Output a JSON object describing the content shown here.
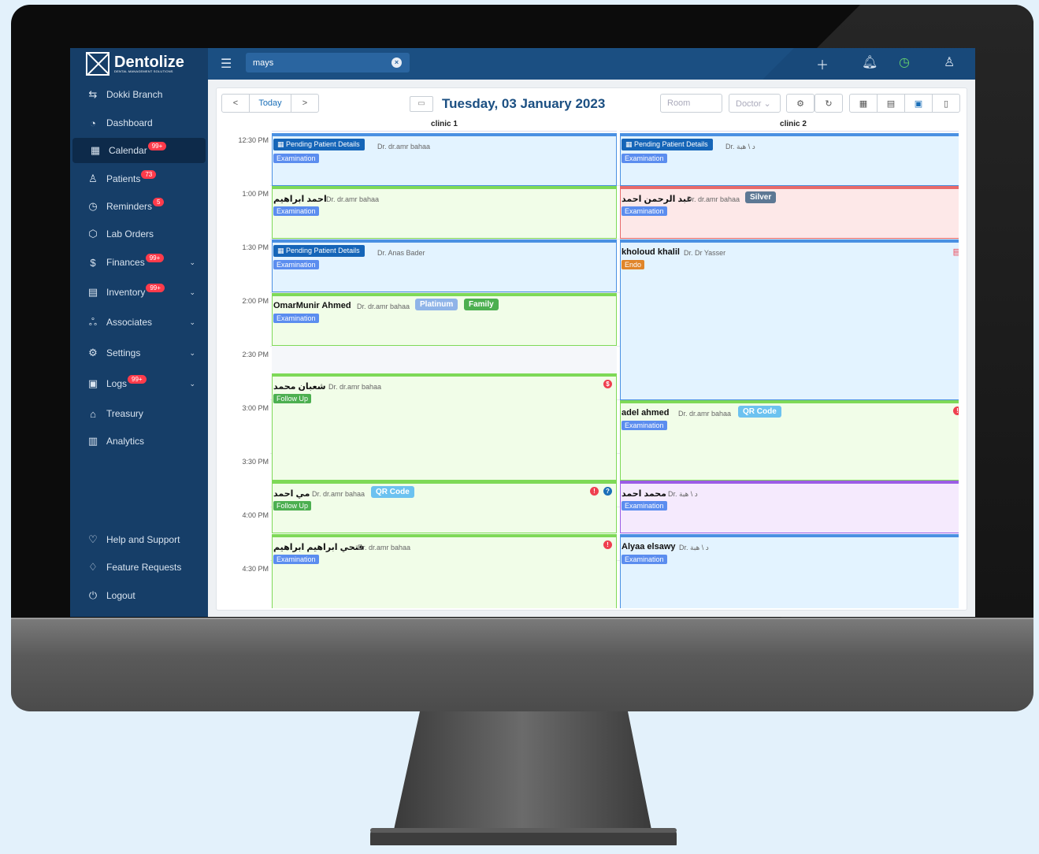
{
  "sidebar": {
    "brand": "Dentolize",
    "brand_sub": "DENTAL MANAGEMENT SOLUTIONS",
    "branch": "Dokki Branch",
    "items": [
      {
        "label": "Dashboard",
        "icon": "dashboard-icon"
      },
      {
        "label": "Calendar",
        "badge": "99+",
        "icon": "calendar-icon"
      },
      {
        "label": "Patients",
        "badge": "73",
        "icon": "patients-icon"
      },
      {
        "label": "Reminders",
        "badge": "5",
        "icon": "reminder-icon"
      },
      {
        "label": "Lab Orders",
        "icon": "lab-icon"
      },
      {
        "label": "Finances",
        "badge": "99+",
        "icon": "finance-icon"
      },
      {
        "label": "Inventory",
        "badge": "99+",
        "icon": "inventory-icon"
      },
      {
        "label": "Associates",
        "icon": "associates-icon"
      },
      {
        "label": "Settings",
        "icon": "settings-icon"
      },
      {
        "label": "Logs",
        "badge": "99+",
        "icon": "logs-icon"
      },
      {
        "label": "Treasury",
        "icon": "treasury-icon"
      },
      {
        "label": "Analytics",
        "icon": "analytics-icon"
      }
    ],
    "footer": [
      {
        "label": "Help and Support",
        "icon": "heart-icon"
      },
      {
        "label": "Feature Requests",
        "icon": "feature-icon"
      },
      {
        "label": "Logout",
        "icon": "power-icon"
      }
    ]
  },
  "topbar": {
    "search_value": "mays",
    "icons": [
      "plus-icon",
      "bell-icon",
      "clock-icon",
      "user-icon"
    ]
  },
  "toolbar": {
    "prev": "<",
    "today": "Today",
    "next": ">",
    "date_title": "Tuesday, 03 January 2023",
    "room_placeholder": "Room",
    "doctor_placeholder": "Doctor"
  },
  "calendar": {
    "columns": [
      "clinic 1",
      "clinic 2"
    ],
    "times": [
      "12:30 PM",
      "1:00 PM",
      "1:30 PM",
      "2:00 PM",
      "2:30 PM",
      "3:00 PM",
      "3:30 PM",
      "4:00 PM",
      "4:30 PM"
    ],
    "appointments": {
      "c1_1": {
        "pending": "Pending Patient Details",
        "doctor": "Dr. dr.amr bahaa",
        "tag": "Examination"
      },
      "c1_2": {
        "name": "احمد ابراهيم",
        "doctor": "Dr. dr.amr bahaa",
        "tag": "Examination"
      },
      "c1_3": {
        "pending": "Pending Patient Details",
        "doctor": "Dr. Anas Bader",
        "tag": "Examination"
      },
      "c1_4": {
        "name": "OmarMunir Ahmed",
        "doctor": "Dr. dr.amr bahaa",
        "badge1": "Platinum",
        "badge2": "Family",
        "tag": "Examination"
      },
      "c1_5": {
        "name": "شعبان محمد",
        "doctor": "Dr. dr.amr bahaa",
        "tag": "Follow Up",
        "dot": "$"
      },
      "c1_6": {
        "name": "مي احمد",
        "doctor": "Dr. dr.amr bahaa",
        "badge1": "QR Code",
        "tag": "Follow Up",
        "dot1": "!",
        "dot2": "?"
      },
      "c1_7": {
        "name": "فتحي ابراهيم ابراهيم",
        "doctor": "Dr. dr.amr bahaa",
        "tag": "Examination",
        "dot": "!"
      },
      "c2_1": {
        "pending": "Pending Patient Details",
        "doctor": "Dr. د \\ هبة",
        "tag": "Examination"
      },
      "c2_2": {
        "name": "عبد الرحمن احمد",
        "doctor": "Dr. dr.amr bahaa",
        "badge1": "Silver",
        "tag": "Examination"
      },
      "c2_3": {
        "name": "kholoud khalil",
        "doctor": "Dr. Dr Yasser",
        "tag": "Endo"
      },
      "c2_4": {
        "name": "adel ahmed",
        "doctor": "Dr. dr.amr bahaa",
        "badge1": "QR Code",
        "tag": "Examination",
        "dot": "!"
      },
      "c2_5": {
        "name": "محمد احمد",
        "doctor": "Dr. د \\ هبة",
        "tag": "Examination"
      },
      "c2_6": {
        "name": "Alyaa elsawy",
        "doctor": "Dr. د \\ هبة",
        "tag": "Examination"
      }
    }
  },
  "colors": {
    "sidebar": "#163e68",
    "topbar": "#1b4f82",
    "examination": "#5b8def",
    "followup": "#4caf50",
    "endo": "#e0852a",
    "blue_card": "#e3f3ff",
    "green_card": "#f1fde8",
    "red_card": "#fde8e8",
    "purple_card": "#f5eafd"
  }
}
